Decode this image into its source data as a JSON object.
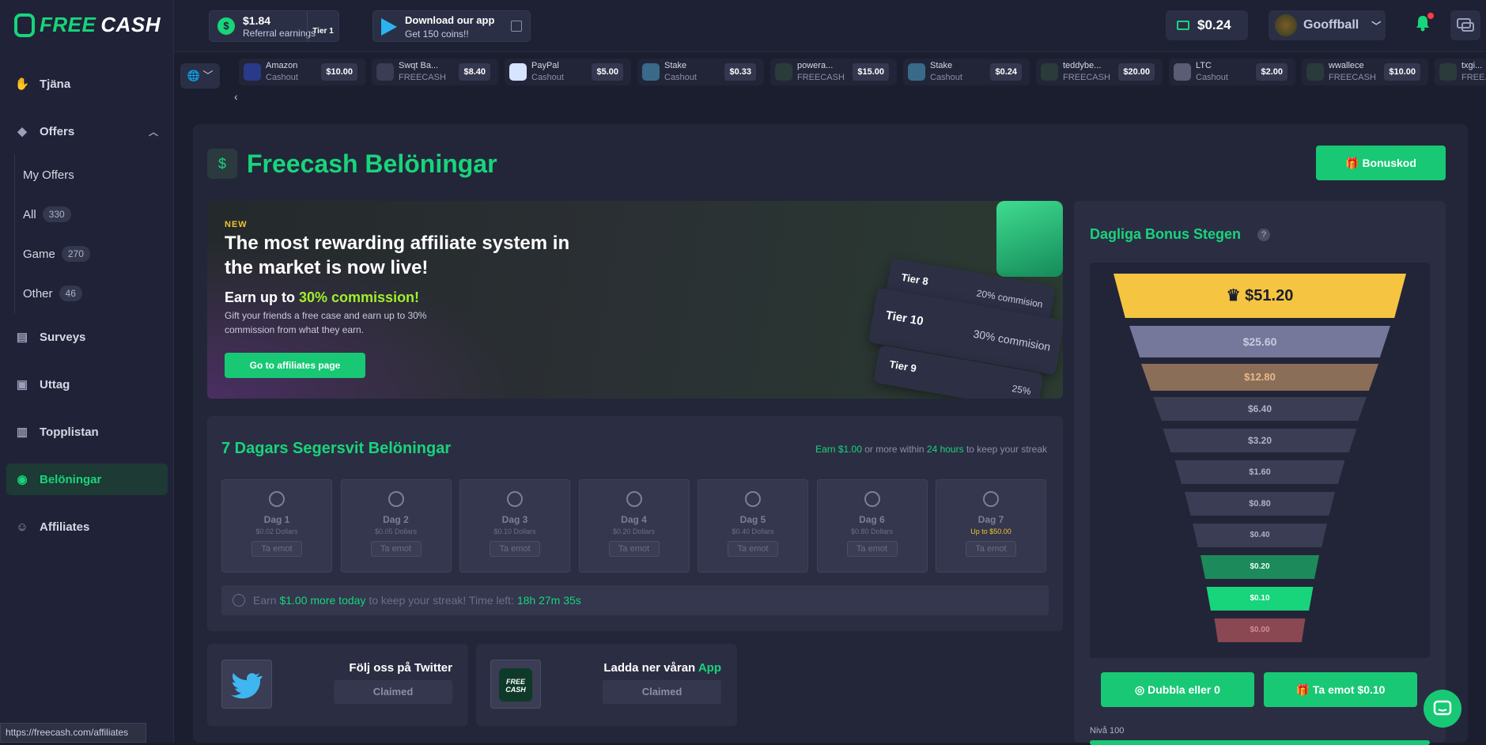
{
  "logo": {
    "f1": "FREE",
    "f2": "CASH"
  },
  "top": {
    "referral_amount": "$1.84",
    "referral_label": "Referral earnings",
    "tier": "Tier 1",
    "app_title": "Download our app",
    "app_sub": "Get 150 coins!!",
    "balance": "$0.24",
    "username": "Gooffball"
  },
  "nav": {
    "tjana": "Tjäna",
    "offers": "Offers",
    "my_offers": "My Offers",
    "all": "All",
    "all_count": "330",
    "game": "Game",
    "game_count": "270",
    "other": "Other",
    "other_count": "46",
    "surveys": "Surveys",
    "uttag": "Uttag",
    "topplistan": "Topplistan",
    "belonigar": "Belöningar",
    "affiliates": "Affiliates"
  },
  "ticker": [
    {
      "name": "Amazon",
      "sub": "Cashout",
      "value": "$10.00",
      "color": "#2a3a8a"
    },
    {
      "name": "Swqt Ba...",
      "sub": "FREECASH",
      "value": "$8.40",
      "color": "#3a3d53"
    },
    {
      "name": "PayPal",
      "sub": "Cashout",
      "value": "$5.00",
      "color": "#d6e4ff"
    },
    {
      "name": "Stake",
      "sub": "Cashout",
      "value": "$0.33",
      "color": "#3a6a8a"
    },
    {
      "name": "powera...",
      "sub": "FREECASH",
      "value": "$15.00",
      "color": "#2b3a3a"
    },
    {
      "name": "Stake",
      "sub": "Cashout",
      "value": "$0.24",
      "color": "#3a6a8a"
    },
    {
      "name": "teddybe...",
      "sub": "FREECASH",
      "value": "$20.00",
      "color": "#2b3a3a"
    },
    {
      "name": "LTC",
      "sub": "Cashout",
      "value": "$2.00",
      "color": "#5a5d73"
    },
    {
      "name": "wwallece",
      "sub": "FREECASH",
      "value": "$10.00",
      "color": "#2b3a3a"
    },
    {
      "name": "txgi...",
      "sub": "FREE...",
      "value": "",
      "color": "#2b3a3a"
    }
  ],
  "page": {
    "title": "Freecash Belöningar",
    "bonus_button": "Bonuskod"
  },
  "banner": {
    "tag": "NEW",
    "headline": "The most rewarding affiliate system in the market is now live!",
    "sub_prefix": "Earn up to ",
    "sub_highlight": "30% commission!",
    "desc": "Gift your friends a free case and earn up to 30% commission from what they earn.",
    "button": "Go to affiliates page",
    "tier8": "Tier 8",
    "tier8_c": "20% commision",
    "tier10": "Tier 10",
    "tier10_c": "30% commision",
    "tier9": "Tier 9",
    "tier9_c": "25%"
  },
  "streak": {
    "title": "7 Dagars Segersvit Belöningar",
    "note_a": "Earn ",
    "note_amount": "$1.00",
    "note_b": " or more within ",
    "note_time": "24 hours",
    "note_c": " to keep your streak",
    "days": [
      {
        "name": "Dag 1",
        "value": "$0.02 Dollars",
        "btn": "Ta emot"
      },
      {
        "name": "Dag 2",
        "value": "$0.05 Dollars",
        "btn": "Ta emot"
      },
      {
        "name": "Dag 3",
        "value": "$0.10 Dollars",
        "btn": "Ta emot"
      },
      {
        "name": "Dag 4",
        "value": "$0.20 Dollars",
        "btn": "Ta emot"
      },
      {
        "name": "Dag 5",
        "value": "$0.40 Dollars",
        "btn": "Ta emot"
      },
      {
        "name": "Dag 6",
        "value": "$0.80 Dollars",
        "btn": "Ta emot"
      },
      {
        "name": "Dag 7",
        "value": "Up to $50.00",
        "btn": "Ta emot"
      }
    ],
    "bar_a": "Earn ",
    "bar_amount": "$1.00 more today",
    "bar_b": " to keep your streak! Time left: ",
    "bar_time": "18h 27m 35s"
  },
  "social": {
    "twitter_title": "Följ oss på Twitter",
    "twitter_status": "Claimed",
    "app_title_a": "Ladda ner våran ",
    "app_title_b": "App",
    "app_status": "Claimed",
    "app_logo": "FREE CASH"
  },
  "ladder": {
    "title": "Dagliga Bonus Stegen",
    "help": "?",
    "steps": [
      "$51.20",
      "$25.60",
      "$12.80",
      "$6.40",
      "$3.20",
      "$1.60",
      "$0.80",
      "$0.40",
      "$0.20",
      "$0.10",
      "$0.00"
    ],
    "double_btn": "Dubbla eller 0",
    "claim_btn": "Ta emot $0.10",
    "level": "Nivå 100"
  },
  "status_url": "https://freecash.com/affiliates"
}
